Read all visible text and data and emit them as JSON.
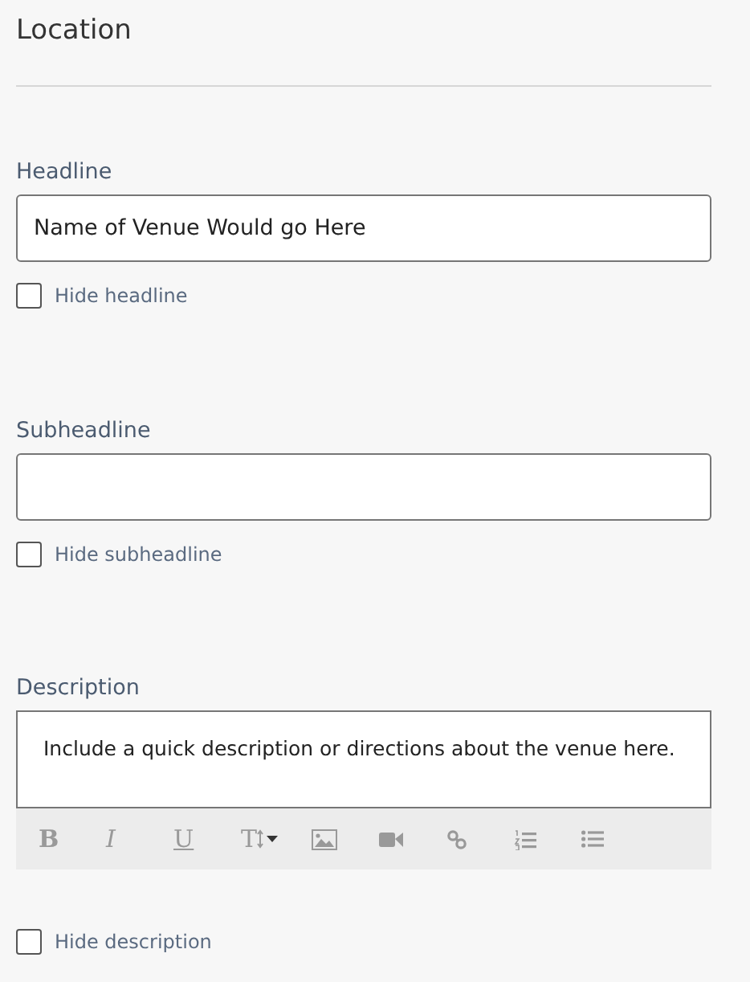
{
  "section": {
    "title": "Location"
  },
  "fields": [
    {
      "kind": "input",
      "label": "Headline",
      "value": "Name of Venue Would go Here",
      "checkbox": {
        "label": "Hide headline",
        "checked": false
      }
    },
    {
      "kind": "input",
      "label": "Subheadline",
      "checkbox": {
        "label": "Hide subheadline",
        "checked": false
      }
    },
    {
      "kind": "editor",
      "label": "Description",
      "value": "Include a quick description or directions about the venue here.",
      "toolbar": [
        {
          "kind": "bold",
          "label": "B"
        },
        {
          "kind": "italic",
          "label": "I"
        },
        {
          "kind": "underline",
          "label": "U"
        },
        {
          "kind": "size",
          "label": "T"
        },
        {
          "kind": "image"
        },
        {
          "kind": "video"
        },
        {
          "kind": "link"
        },
        {
          "kind": "ordered-list"
        },
        {
          "kind": "bullet-list"
        }
      ],
      "checkbox": {
        "label": "Hide description",
        "checked": false
      }
    }
  ]
}
